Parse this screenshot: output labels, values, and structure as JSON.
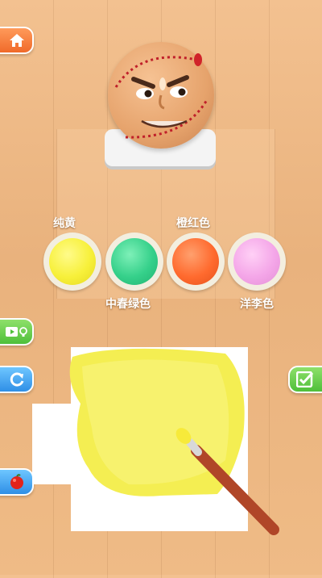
{
  "colors": {
    "home": "#f06a2a",
    "video": "#4fbf3a",
    "replay": "#2f8fe6",
    "check": "#4fbf3a",
    "paint_yellow": "#f7f03a",
    "paint_green": "#35d08a",
    "paint_orange": "#ff6a2e",
    "paint_pink": "#f4a6e8"
  },
  "paints": {
    "yellow_label": "纯黄",
    "orange_label": "橙红色",
    "green_label": "中春绿色",
    "pink_label": "洋李色"
  },
  "icons": {
    "home": "home-icon",
    "video": "video-hint-icon",
    "replay": "replay-icon",
    "apple": "apple-icon",
    "check": "checkmark-icon"
  }
}
